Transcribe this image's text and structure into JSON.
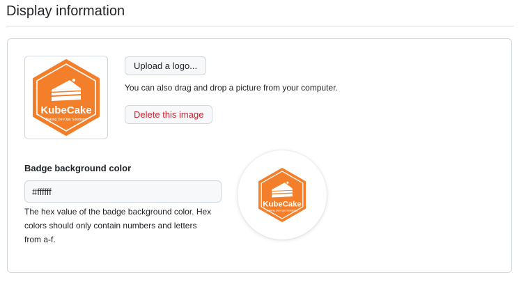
{
  "section": {
    "title": "Display information"
  },
  "logo": {
    "upload_label": "Upload a logo...",
    "hint": "You can also drag and drop a picture from your computer.",
    "delete_label": "Delete this image",
    "brand_name": "KubeCake",
    "brand_tagline": "Baking DevOps Solutions",
    "brand_color": "#f47f2a"
  },
  "badge": {
    "label": "Badge background color",
    "value": "#ffffff",
    "help": "The hex value of the badge background color. Hex colors should only contain numbers and letters from a-f."
  },
  "colors": {
    "danger": "#cf222e",
    "border": "#d0d7de",
    "input_bg": "#f6f8fa"
  },
  "icons": {
    "logo": "kubecake-logo-icon",
    "cake": "cake-slice-icon"
  }
}
